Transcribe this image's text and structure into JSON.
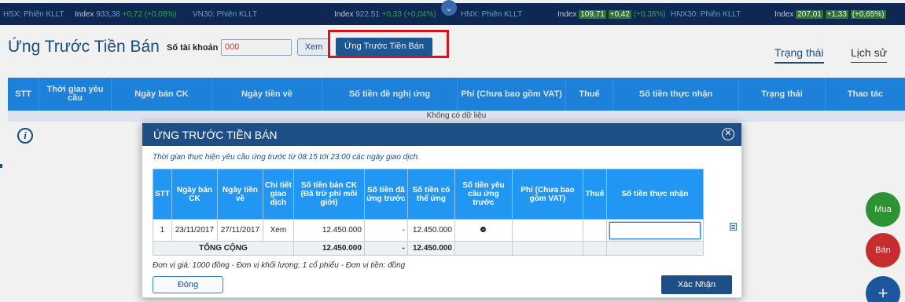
{
  "ticker": {
    "items": [
      {
        "exchange": "HSX: Phiên KLLT",
        "index_label": "Index",
        "index_value": "933,38",
        "change": "+0,72",
        "pct": "(+0,08%)"
      },
      {
        "exchange": "VN30: Phiên KLLT",
        "index_label": "Index",
        "index_value": "922,51",
        "change": "+0,33",
        "pct": "(+0,04%)"
      },
      {
        "exchange": "HNX: Phiên KLLT",
        "index_label": "Index",
        "index_value": "109,71",
        "change": "+0,42",
        "pct": "(+0,38%)"
      },
      {
        "exchange": "HNX30: Phiên KLLT",
        "index_label": "Index",
        "index_value": "207,01",
        "change": "+1,33",
        "pct": "(+0,65%)"
      }
    ],
    "chevron": "⌄",
    "colors": {
      "bar": "#0e2a57",
      "up": "#2bb34a"
    }
  },
  "page": {
    "title": "Ứng Trước Tiền Bán",
    "account_label": "Số tài khoản",
    "account_value": "000",
    "view_button": "Xem",
    "advance_button": "Ứng Trước Tiền Bán",
    "tab_status": "Trạng thái",
    "tab_history": "Lịch sử"
  },
  "main_table": {
    "headers": [
      "STT",
      "Thời gian yêu cầu",
      "Ngày bán CK",
      "Ngày tiền về",
      "Số tiền đề nghị ứng",
      "Phí (Chưa bao gồm VAT)",
      "Thuế",
      "Số tiền thực nhận",
      "Trạng thái",
      "Thao tác"
    ],
    "empty_text": "Không có dữ liệu"
  },
  "fabs": {
    "buy": "Mua",
    "sell": "Bán",
    "add": "+"
  },
  "modal": {
    "title": "ỨNG TRƯỚC TIỀN BÁN",
    "note": "Thời gian thực hiện yêu cầu ứng trước từ 08:15 tới 23:00 các ngày giao dịch.",
    "headers": [
      "STT",
      "Ngày bán CK",
      "Ngày tiền về",
      "Chi tiết giao dịch",
      "Số tiền bán CK (Đã trừ phí môi giới)",
      "Số tiền đã ứng trước",
      "Số tiền có thể ứng",
      "Số tiền yêu cầu ứng trước",
      "Phí (Chưa bao gồm VAT)",
      "Thuế",
      "Số tiền thực nhận"
    ],
    "rows": [
      {
        "stt": "1",
        "sell_date": "23/11/2017",
        "pay_date": "27/11/2017",
        "detail": "Xem",
        "sell_amount": "12.450.000",
        "advanced": "-",
        "available": "12.450.000",
        "fee": "",
        "tax": "",
        "received": ""
      }
    ],
    "total": {
      "label": "TỔNG CỘNG",
      "sell_amount": "12.450.000",
      "advanced": "-",
      "available": "12.450.000"
    },
    "unit_note": "Đơn vị giá: 1000 đồng - Đơn vị khối lượng: 1 cổ phiếu - Đơn vị tiền: đồng",
    "close_button": "Đóng",
    "confirm_button": "Xác Nhận"
  }
}
